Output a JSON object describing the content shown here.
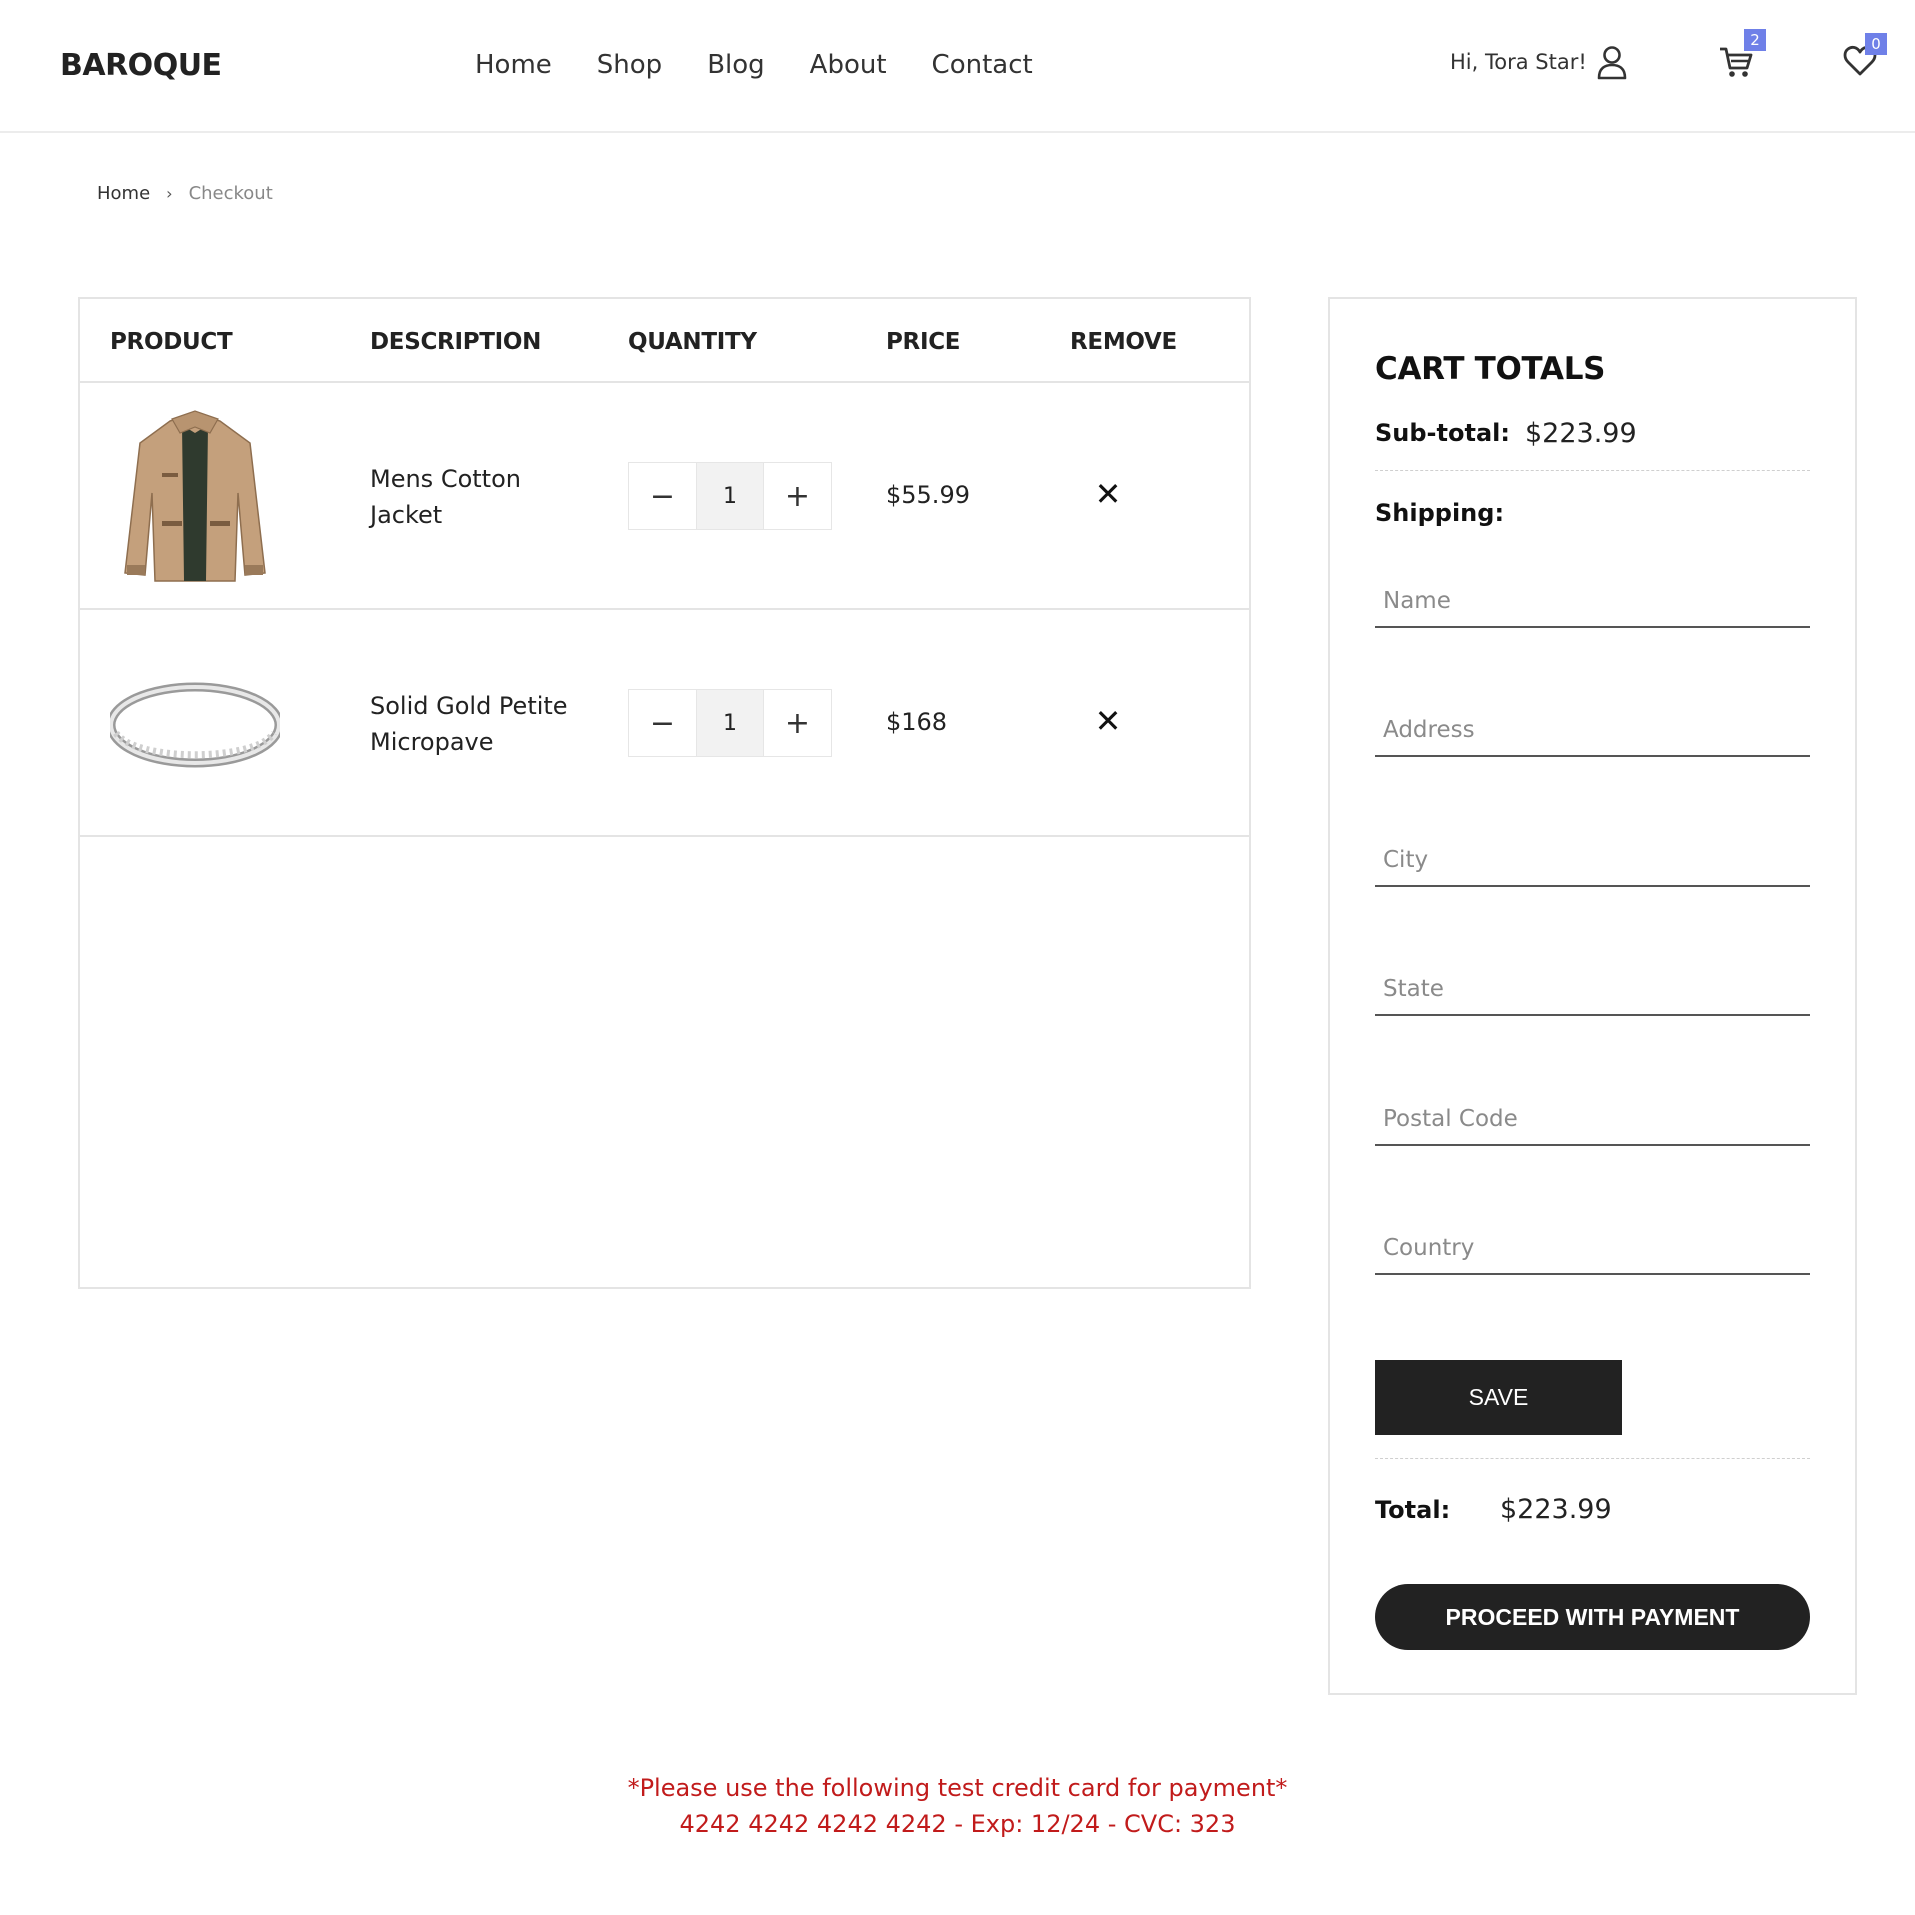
{
  "header": {
    "logo": "BAROQUE",
    "nav": [
      "Home",
      "Shop",
      "Blog",
      "About",
      "Contact"
    ],
    "greeting": "Hi, Tora Star!",
    "cart_count": "2",
    "wishlist_count": "0",
    "badge_color": "#6f80e8"
  },
  "breadcrumb": {
    "home": "Home",
    "separator": "›",
    "current": "Checkout"
  },
  "cart": {
    "columns": [
      "PRODUCT",
      "DESCRIPTION",
      "QUANTITY",
      "PRICE",
      "REMOVE"
    ],
    "items": [
      {
        "image": "jacket",
        "description": "Mens Cotton Jacket",
        "quantity": "1",
        "price": "$55.99"
      },
      {
        "image": "ring",
        "description": "Solid Gold Petite Micropave",
        "quantity": "1",
        "price": "$168"
      }
    ],
    "minus": "−",
    "plus": "+",
    "remove": "✕"
  },
  "totals": {
    "title": "CART TOTALS",
    "subtotal_label": "Sub-total:",
    "subtotal_value": "$223.99",
    "shipping_label": "Shipping:",
    "fields": {
      "name": "Name",
      "address": "Address",
      "city": "City",
      "state": "State",
      "postal_code": "Postal Code",
      "country": "Country"
    },
    "save_label": "SAVE",
    "total_label": "Total:",
    "total_value": "$223.99",
    "pay_label": "PROCEED WITH PAYMENT"
  },
  "note": {
    "line1": "*Please use the following test credit card for payment*",
    "line2": "4242 4242 4242 4242 - Exp: 12/24 - CVC: 323",
    "color": "#c11b1b"
  }
}
